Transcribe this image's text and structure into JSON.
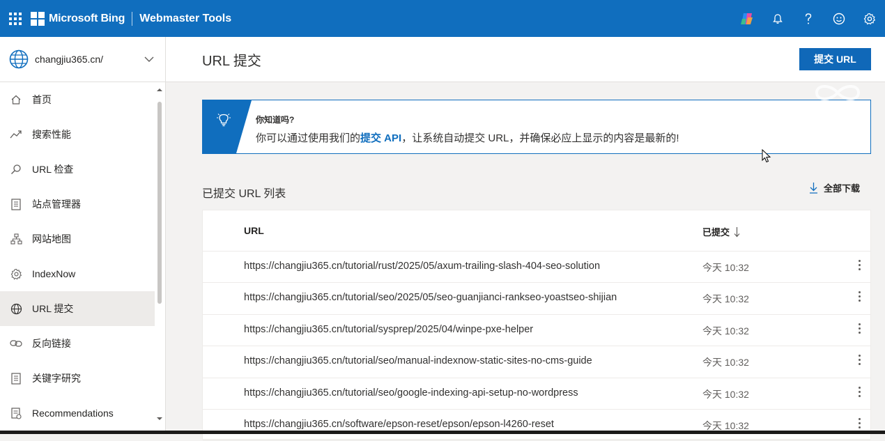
{
  "topbar": {
    "brand": "Microsoft Bing",
    "product": "Webmaster Tools",
    "icons": [
      "copilot-icon",
      "bell-icon",
      "help-icon",
      "feedback-icon",
      "gear-icon"
    ]
  },
  "sidebar": {
    "site": "changjiu365.cn/",
    "items": [
      {
        "label": "首页",
        "icon": "home-icon"
      },
      {
        "label": "搜索性能",
        "icon": "trend-icon"
      },
      {
        "label": "URL 检查",
        "icon": "search-icon"
      },
      {
        "label": "站点管理器",
        "icon": "document-icon"
      },
      {
        "label": "网站地图",
        "icon": "sitemap-icon"
      },
      {
        "label": "IndexNow",
        "icon": "gear-icon"
      },
      {
        "label": "URL 提交",
        "icon": "globe-icon",
        "active": true
      },
      {
        "label": "反向链接",
        "icon": "link-icon"
      },
      {
        "label": "关键字研究",
        "icon": "document-icon"
      },
      {
        "label": "Recommendations",
        "icon": "recommendations-icon"
      }
    ]
  },
  "main": {
    "title": "URL 提交",
    "submit_button": "提交 URL",
    "tip": {
      "title": "你知道吗?",
      "body_before": "你可以通过使用我们的",
      "link": "提交 API",
      "body_after": "，让系统自动提交 URL，并确保必应上显示的内容是最新的!"
    },
    "list_title": "已提交 URL 列表",
    "download": "全部下载",
    "table": {
      "col_url": "URL",
      "col_date": "已提交",
      "rows": [
        {
          "url": "https://changjiu365.cn/tutorial/rust/2025/05/axum-trailing-slash-404-seo-solution",
          "date": "今天 10:32"
        },
        {
          "url": "https://changjiu365.cn/tutorial/seo/2025/05/seo-guanjianci-rankseo-yoastseo-shijian",
          "date": "今天 10:32"
        },
        {
          "url": "https://changjiu365.cn/tutorial/sysprep/2025/04/winpe-pxe-helper",
          "date": "今天 10:32"
        },
        {
          "url": "https://changjiu365.cn/tutorial/seo/manual-indexnow-static-sites-no-cms-guide",
          "date": "今天 10:32"
        },
        {
          "url": "https://changjiu365.cn/tutorial/seo/google-indexing-api-setup-no-wordpress",
          "date": "今天 10:32"
        },
        {
          "url": "https://changjiu365.cn/software/epson-reset/epson/epson-l4260-reset",
          "date": "今天 10:32"
        }
      ]
    }
  },
  "colors": {
    "accent": "#106ebe",
    "button": "#1068b8",
    "active_nav": "#edebe9"
  }
}
